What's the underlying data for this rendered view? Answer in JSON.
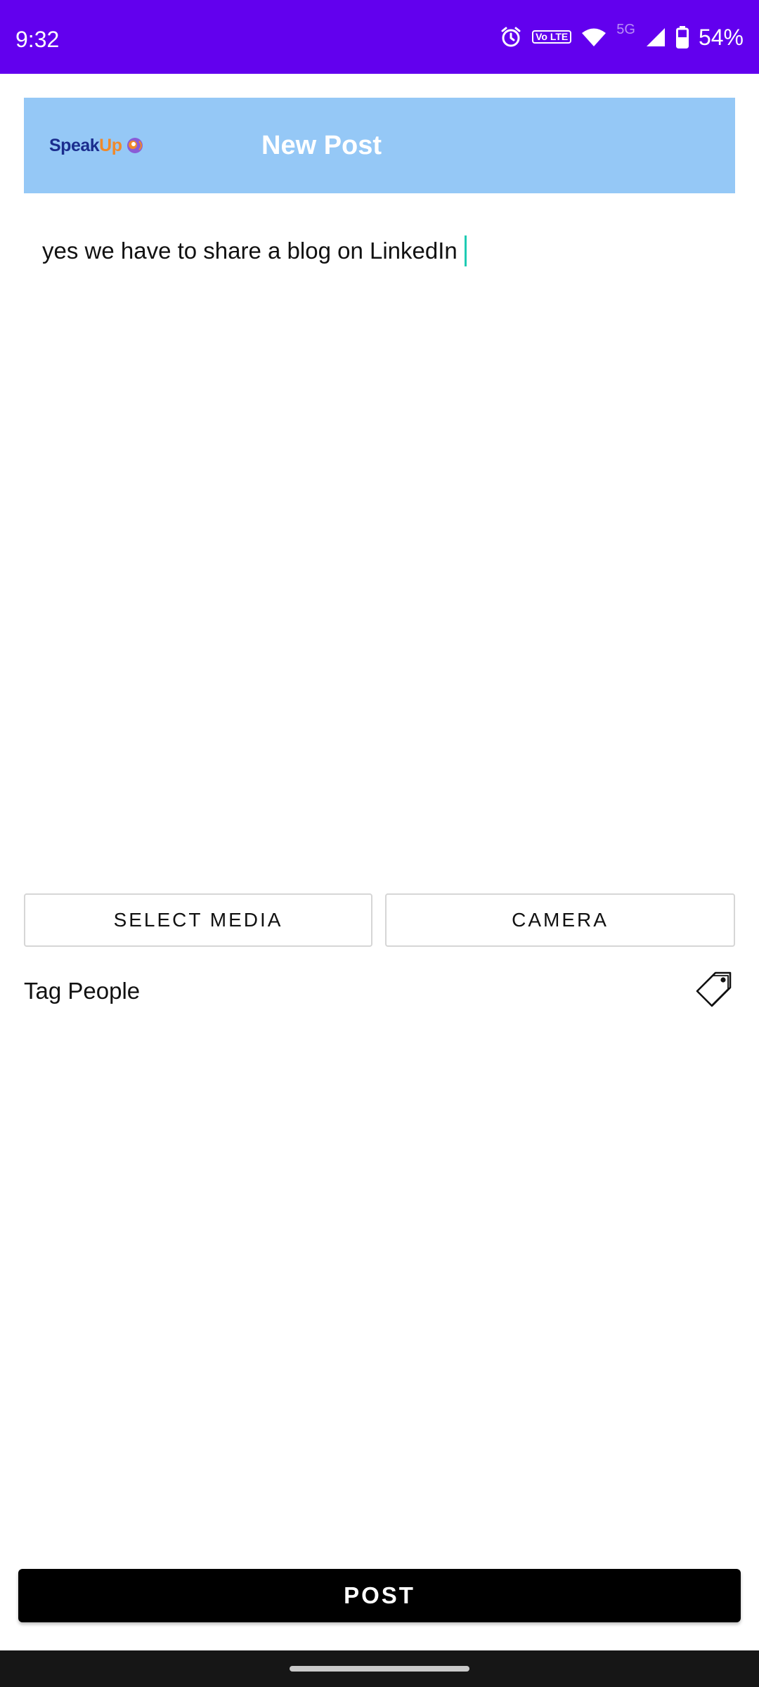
{
  "status_bar": {
    "time": "9:32",
    "volte_label": "Vo LTE",
    "network_label": "5G",
    "battery_percent": "54%",
    "icons": [
      "alarm-icon",
      "volte-icon",
      "wifi-icon",
      "signal-icon",
      "battery-icon"
    ]
  },
  "header": {
    "logo_part1": "Speak",
    "logo_part2": "Up",
    "title": "New Post",
    "colors": {
      "background": "#95c8f6",
      "logo_primary": "#1b2d8e",
      "logo_accent": "#f0892a"
    }
  },
  "composer": {
    "text_value": "yes we have to share a blog on LinkedIn",
    "caret_color": "#1fcbb3"
  },
  "media_buttons": {
    "select_media": "SELECT MEDIA",
    "camera": "CAMERA"
  },
  "tag_people": {
    "label": "Tag People",
    "icon": "tag-icon"
  },
  "post_button": {
    "label": "POST"
  },
  "theme": {
    "status_bar_color": "#6200ee",
    "nav_bar_color": "#161616"
  }
}
